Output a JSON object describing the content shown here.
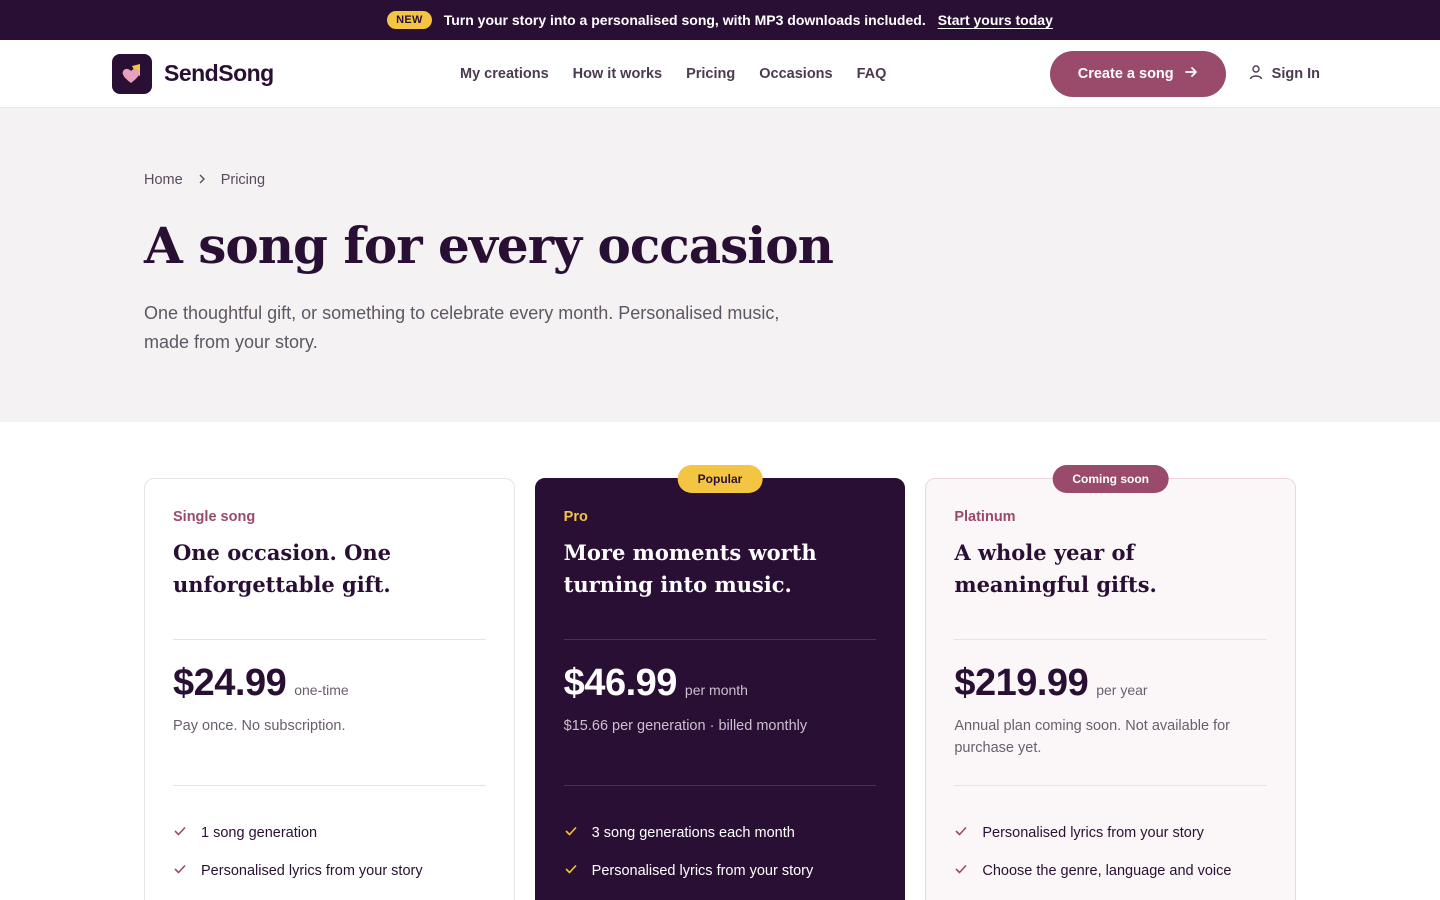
{
  "announcement": {
    "badge": "NEW",
    "text": "Turn your story into a personalised song, with MP3 downloads included.",
    "cta": "Start yours today"
  },
  "header": {
    "brand": "SendSong",
    "nav": [
      "My creations",
      "How it works",
      "Pricing",
      "Occasions",
      "FAQ"
    ],
    "create_button": "Create a song",
    "signin": "Sign In"
  },
  "breadcrumb": [
    "Home",
    "Pricing"
  ],
  "hero": {
    "title": "A song for every occasion",
    "subtitle": "One thoughtful gift, or something to celebrate every month. Personalised music, made from your story."
  },
  "plans": [
    {
      "tier": "Single song",
      "badge": "",
      "headline": "One occasion. One unforgettable gift.",
      "price": "$24.99",
      "period": "one-time",
      "note": "Pay once. No subscription.",
      "features": [
        "1 song generation",
        "Personalised lyrics from your story"
      ]
    },
    {
      "tier": "Pro",
      "badge": "Popular",
      "headline": "More moments worth turning into music.",
      "price": "$46.99",
      "period": "per month",
      "note": "$15.66 per generation · billed monthly",
      "features": [
        "3 song generations each month",
        "Personalised lyrics from your story"
      ]
    },
    {
      "tier": "Platinum",
      "badge": "Coming soon",
      "headline": "A whole year of meaningful gifts.",
      "price": "$219.99",
      "period": "per year",
      "note": "Annual plan coming soon. Not available for purchase yet.",
      "features": [
        "Personalised lyrics from your story",
        "Choose the genre, language and voice"
      ]
    }
  ],
  "colors": {
    "brand_dark": "#2a0f34",
    "accent_rose": "#9a4a6a",
    "accent_gold": "#f4c542",
    "hero_bg": "#f5f2f3"
  },
  "icons": {
    "logo": "heart-music-logo-icon",
    "breadcrumb_sep": "chevron-right-icon",
    "create_arrow": "arrow-right-icon",
    "user": "user-icon",
    "feature": "check-icon"
  }
}
